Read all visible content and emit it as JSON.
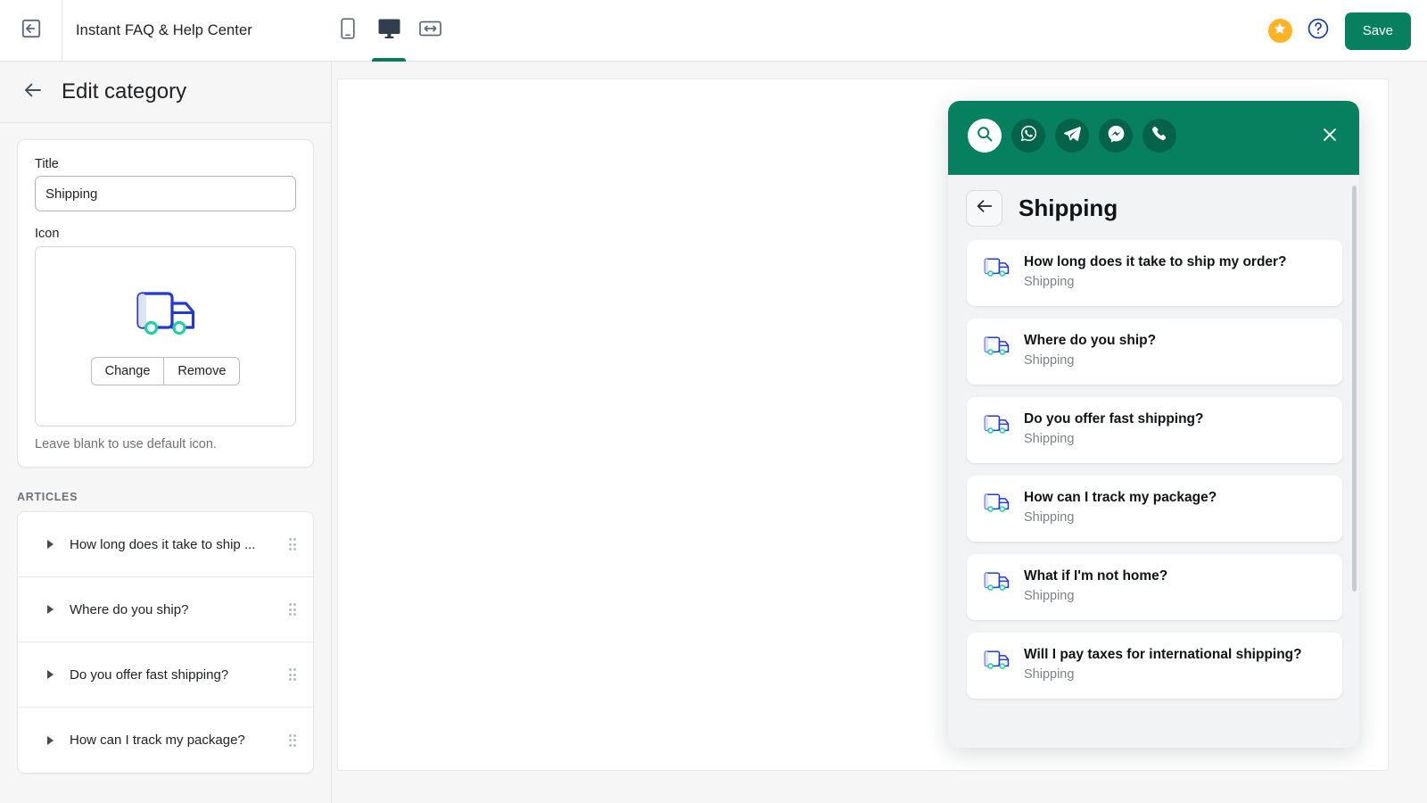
{
  "topbar": {
    "exit_icon": "exit-app-icon",
    "app_title": "Instant FAQ & Help Center",
    "devices": [
      {
        "name": "mobile",
        "icon": "mobile-icon",
        "active": false
      },
      {
        "name": "desktop",
        "icon": "desktop-icon",
        "active": true
      },
      {
        "name": "fullwidth",
        "icon": "full-width-icon",
        "active": false
      }
    ],
    "star_icon": "star-icon",
    "help_icon": "question-mark-icon",
    "save_label": "Save"
  },
  "left_panel": {
    "back_icon": "arrow-left-icon",
    "header_title": "Edit category",
    "title_label": "Title",
    "title_value": "Shipping",
    "icon_label": "Icon",
    "icon_preview": "delivery-truck-icon",
    "change_label": "Change",
    "remove_label": "Remove",
    "hint": "Leave blank to use default icon.",
    "articles_section": "ARTICLES",
    "articles": [
      {
        "title": "How long does it take to ship ..."
      },
      {
        "title": "Where do you ship?"
      },
      {
        "title": "Do you offer fast shipping?"
      },
      {
        "title": "How can I track my package?"
      }
    ]
  },
  "widget": {
    "channels": [
      {
        "name": "search",
        "icon": "search-icon",
        "primary": true
      },
      {
        "name": "whatsapp",
        "icon": "whatsapp-icon",
        "primary": false
      },
      {
        "name": "telegram",
        "icon": "telegram-icon",
        "primary": false
      },
      {
        "name": "messenger",
        "icon": "messenger-icon",
        "primary": false
      },
      {
        "name": "phone",
        "icon": "phone-icon",
        "primary": false
      }
    ],
    "close_icon": "close-icon",
    "back_icon": "arrow-left-icon",
    "category_title": "Shipping",
    "faqs": [
      {
        "question": "How long does it take to ship my order?",
        "category": "Shipping"
      },
      {
        "question": "Where do you ship?",
        "category": "Shipping"
      },
      {
        "question": "Do you offer fast shipping?",
        "category": "Shipping"
      },
      {
        "question": "How can I track my package?",
        "category": "Shipping"
      },
      {
        "question": "What if I'm not home?",
        "category": "Shipping"
      },
      {
        "question": "Will I pay taxes for international shipping?",
        "category": "Shipping"
      }
    ]
  },
  "colors": {
    "brand_green": "#07805f",
    "star_yellow": "#ffb224",
    "truck_blue": "#2238d8",
    "wheel_teal": "#1fd0a3",
    "page_bg": "#f6f6f7"
  }
}
